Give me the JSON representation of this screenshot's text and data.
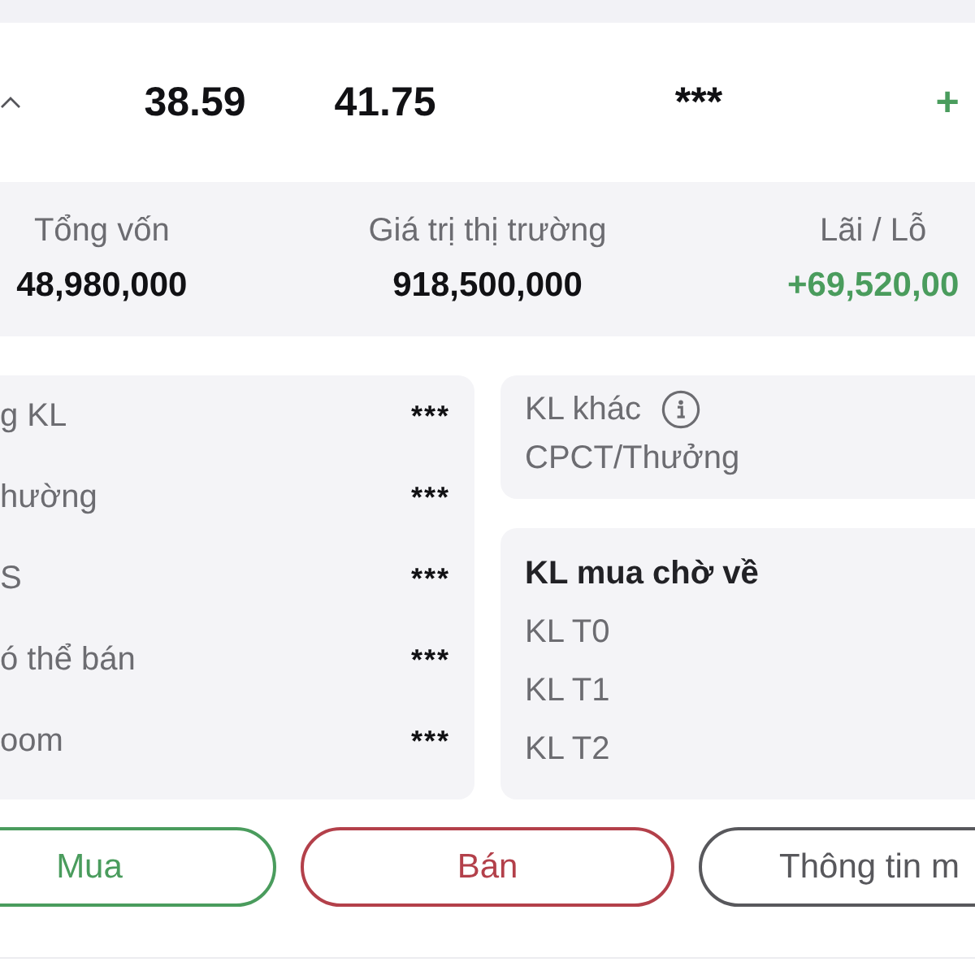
{
  "position_row": {
    "expanded": true,
    "cells": [
      {
        "text": "38.59",
        "kind": "plain"
      },
      {
        "text": "41.75",
        "kind": "plain"
      },
      {
        "text": "***",
        "kind": "plain"
      },
      {
        "text": "+",
        "kind": "gain"
      }
    ]
  },
  "summary": [
    {
      "label": "Tổng vốn",
      "value": "48,980,000",
      "kind": "plain"
    },
    {
      "label": "Giá trị thị trường",
      "value": "918,500,000",
      "kind": "plain"
    },
    {
      "label": "Lãi / Lỗ",
      "value": "+69,520,00",
      "kind": "gain"
    }
  ],
  "holdings": [
    {
      "label": "g KL",
      "value": "***"
    },
    {
      "label": "hường",
      "value": "***"
    },
    {
      "label": "S",
      "value": "***"
    },
    {
      "label": "ó thể bán",
      "value": "***"
    },
    {
      "label": "oom",
      "value": "***"
    }
  ],
  "other_volume": {
    "title": "KL khác",
    "note": "CPCT/Thưởng"
  },
  "pending_buy": {
    "title": "KL mua chờ về",
    "items": [
      "KL T0",
      "KL T1",
      "KL T2"
    ]
  },
  "buttons": [
    {
      "label": "Mua",
      "kind": "buy"
    },
    {
      "label": "Bán",
      "kind": "sell"
    },
    {
      "label": "Thông tin m",
      "kind": "info"
    }
  ]
}
